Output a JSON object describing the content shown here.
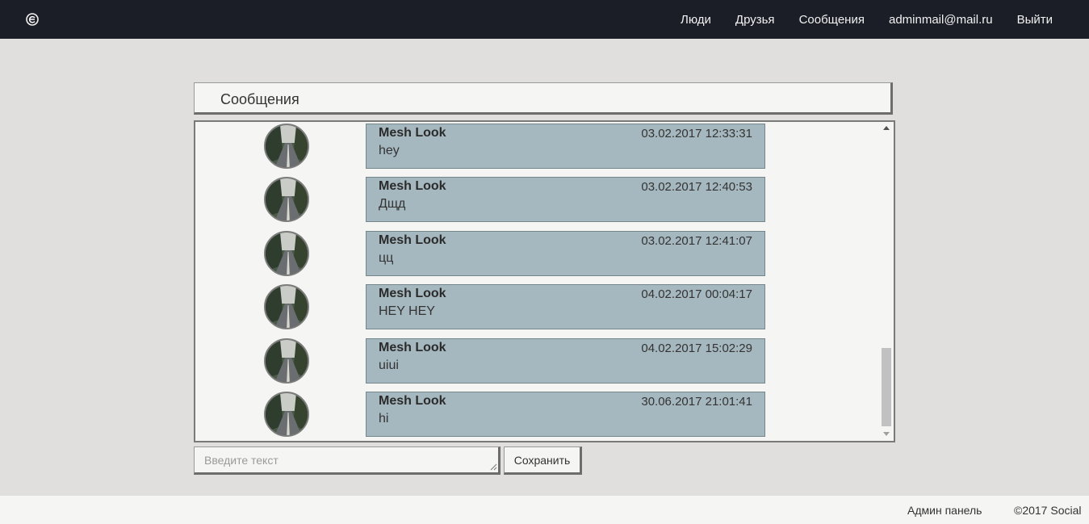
{
  "nav": {
    "links": [
      "Люди",
      "Друзья",
      "Сообщения",
      "adminmail@mail.ru",
      "Выйти"
    ]
  },
  "panel": {
    "title": "Сообщения"
  },
  "messages": [
    {
      "author": "Mesh Look",
      "date": "03.02.2017 12:33:31",
      "text": "hey"
    },
    {
      "author": "Mesh Look",
      "date": "03.02.2017 12:40:53",
      "text": "Дщд"
    },
    {
      "author": "Mesh Look",
      "date": "03.02.2017 12:41:07",
      "text": "цц"
    },
    {
      "author": "Mesh Look",
      "date": "04.02.2017 00:04:17",
      "text": "HEY HEY"
    },
    {
      "author": "Mesh Look",
      "date": "04.02.2017 15:02:29",
      "text": "uiui"
    },
    {
      "author": "Mesh Look",
      "date": "30.06.2017 21:01:41",
      "text": "hi"
    }
  ],
  "composer": {
    "placeholder": "Введите текст",
    "value": "",
    "save_label": "Сохранить"
  },
  "footer": {
    "admin_label": "Админ панель",
    "copyright": "©2017 Social"
  },
  "colors": {
    "navbar": "#1b1e26",
    "page_bg": "#e0dfdd",
    "panel_bg": "#f5f5f3",
    "bubble_bg": "#a6b8bf",
    "bubble_border": "#75858c"
  },
  "icons": {
    "logo": "logo-icon",
    "avatar": "avatar-road-photo",
    "scroll_up": "chevron-up-icon",
    "scroll_down": "chevron-down-icon"
  }
}
